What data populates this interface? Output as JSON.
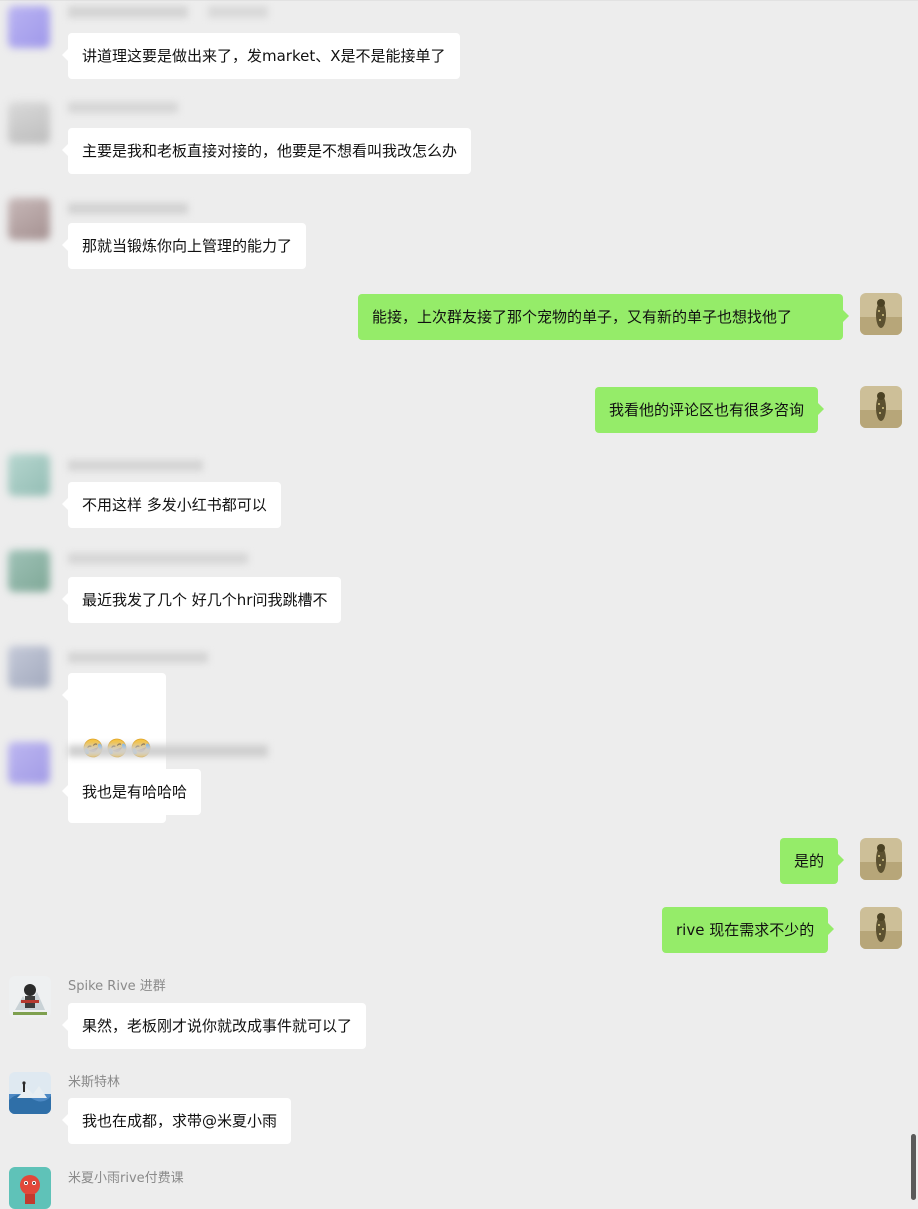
{
  "colors": {
    "background": "#ededed",
    "incoming_bubble": "#ffffff",
    "outgoing_bubble": "#95ec69",
    "sender_name": "#8a8a8a"
  },
  "messages": [
    {
      "direction": "in",
      "sender": "",
      "sender_obscured": true,
      "text": "讲道理这要是做出来了，发market、X是不是能接单了"
    },
    {
      "direction": "in",
      "sender": "",
      "sender_obscured": true,
      "text": "主要是我和老板直接对接的，他要是不想看叫我改怎么办"
    },
    {
      "direction": "in",
      "sender": "",
      "sender_obscured": true,
      "text": "那就当锻炼你向上管理的能力了"
    },
    {
      "direction": "out",
      "text": "能接，上次群友接了那个宠物的单子，又有新的单子也想找他了"
    },
    {
      "direction": "out",
      "text": "我看他的评论区也有很多咨询"
    },
    {
      "direction": "in",
      "sender": "",
      "sender_obscured": true,
      "text": "不用这样 多发小红书都可以"
    },
    {
      "direction": "in",
      "sender": "",
      "sender_obscured": true,
      "text": "最近我发了几个 好几个hr问我跳槽不"
    },
    {
      "direction": "in",
      "sender": "",
      "sender_obscured": true,
      "text": "",
      "emoji": [
        "face-with-tears-of-joy-emoji",
        "face-with-tears-of-joy-emoji",
        "face-with-tears-of-joy-emoji"
      ]
    },
    {
      "direction": "in",
      "sender": "",
      "sender_obscured": true,
      "text": "我也是有哈哈哈"
    },
    {
      "direction": "out",
      "text": "是的"
    },
    {
      "direction": "out",
      "text": "rive 现在需求不少的"
    },
    {
      "direction": "in",
      "sender": "Spike Rive 进群",
      "text": "果然，老板刚才说你就改成事件就可以了"
    },
    {
      "direction": "in",
      "sender": "米斯特林",
      "text": "我也在成都，求带@米夏小雨"
    },
    {
      "direction": "in",
      "sender": "米夏小雨rive付费课",
      "text": ""
    }
  ]
}
